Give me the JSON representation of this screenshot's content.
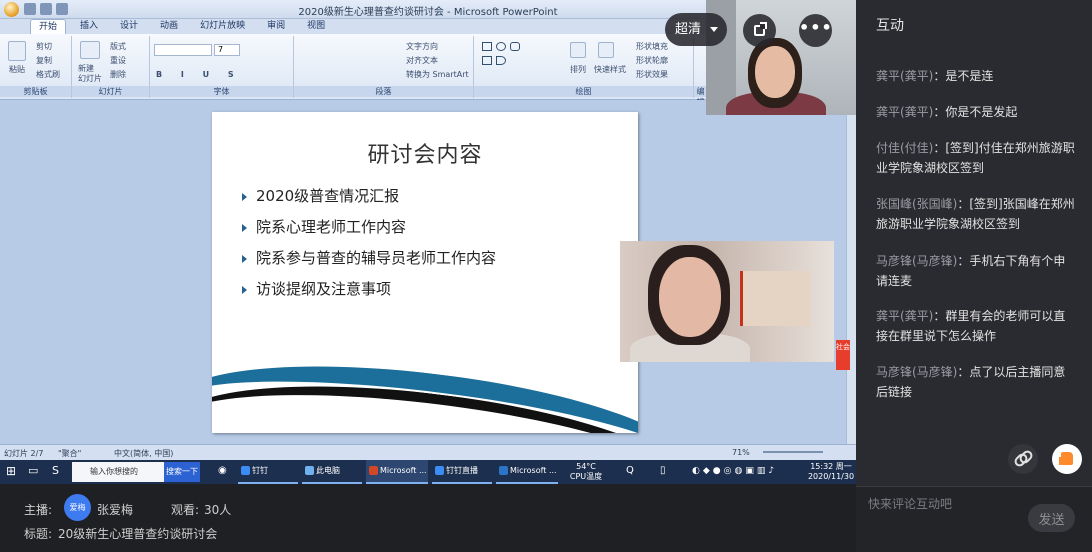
{
  "window": {
    "title": "2020级新生心理普查约谈研讨会 - Microsoft PowerPoint"
  },
  "ribbon": {
    "tabs": [
      "开始",
      "插入",
      "设计",
      "动画",
      "幻灯片放映",
      "审阅",
      "视图"
    ],
    "groups": [
      "剪贴板",
      "幻灯片",
      "字体",
      "段落",
      "绘图",
      "编辑"
    ],
    "paste": "粘贴",
    "cut": "剪切",
    "copy": "复制",
    "format_painter": "格式刷",
    "new_slide": "新建 幻灯片",
    "layout": "版式",
    "reset": "重设",
    "delete": "删除",
    "font_size": "7",
    "text_direction": "文字方向",
    "align_text": "对齐文本",
    "convert_smartart": "转换为 SmartArt",
    "arrange": "排列",
    "quick_styles": "快速样式",
    "shape_fill": "形状填充",
    "shape_outline": "形状轮廓",
    "shape_effects": "形状效果"
  },
  "slide": {
    "title": "研讨会内容",
    "bullets": [
      "2020级普查情况汇报",
      "院系心理老师工作内容",
      "院系参与普查的辅导员老师工作内容",
      "访谈提纲及注意事项"
    ]
  },
  "overlay": {
    "quality": "超清",
    "more": "•••",
    "red_tag": "社会"
  },
  "statusbar": {
    "slide_no": "幻灯片 2/7",
    "theme": "\"聚合\"",
    "lang": "中文(简体, 中国)",
    "zoom": "71%"
  },
  "taskbar": {
    "search_placeholder": "输入你想搜的",
    "search_button": "搜索一下",
    "tasks": [
      "钉钉",
      "此电脑",
      "Microsoft ...",
      "钉钉直播",
      "Microsoft ..."
    ],
    "cpu_temp": "54°C",
    "cpu_label": "CPU温度",
    "time": "15:32 周一",
    "date": "2020/11/30"
  },
  "info": {
    "host_label": "主播:",
    "host_avatar": "爱梅",
    "host_name": "张爱梅",
    "viewers_label": "观看:",
    "viewers": "30人",
    "title_label": "标题:",
    "title": "20级新生心理普查约谈研讨会"
  },
  "chat": {
    "title": "互动",
    "messages": [
      {
        "user": "龚平(龚平)",
        "text": "：是不是连"
      },
      {
        "user": "龚平(龚平)",
        "text": "：你是不是发起"
      },
      {
        "user": "付佳(付佳)",
        "text": "：[签到]付佳在郑州旅游职业学院象湖校区签到"
      },
      {
        "user": "张国峰(张国峰)",
        "text": "：[签到]张国峰在郑州旅游职业学院象湖校区签到"
      },
      {
        "user": "马彦锋(马彦锋)",
        "text": "：手机右下角有个申请连麦"
      },
      {
        "user": "龚平(龚平)",
        "text": "：群里有会的老师可以直接在群里说下怎么操作"
      },
      {
        "user": "马彦锋(马彦锋)",
        "text": "：点了以后主播同意后链接"
      }
    ],
    "input_placeholder": "快来评论互动吧",
    "send": "发送"
  }
}
